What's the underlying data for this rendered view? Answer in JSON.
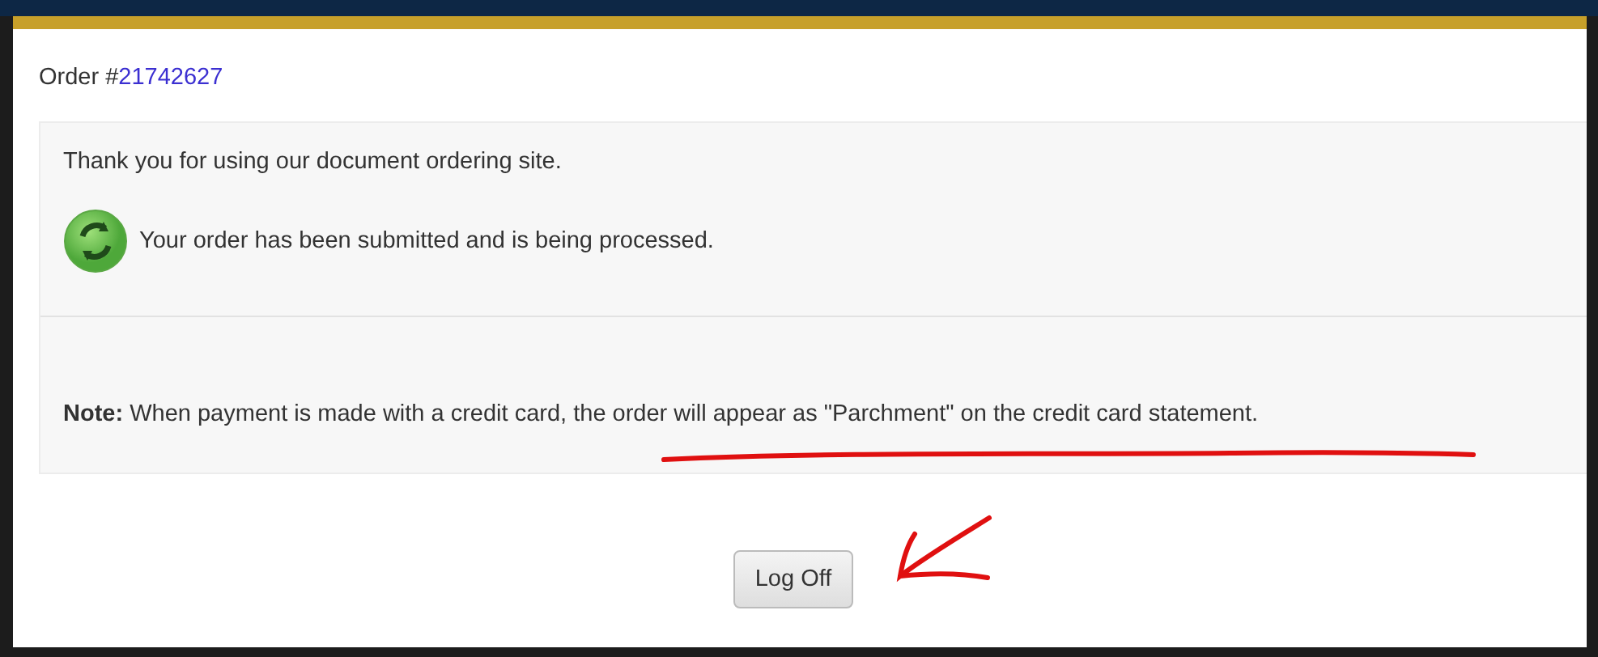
{
  "order": {
    "label": "Order #",
    "number": "21742627"
  },
  "panel": {
    "thanks": "Thank you for using our document ordering site.",
    "status": {
      "kind": "processing",
      "text": "Your order has been submitted and is being processed."
    },
    "note": "**Note:** When payment is made with a credit card, the order will appear as \"Parchment\" on the credit card statement."
  },
  "buttons": [
    "Log Off"
  ],
  "annotations": [
    {
      "kind": "underline"
    },
    {
      "kind": "arrow"
    }
  ]
}
